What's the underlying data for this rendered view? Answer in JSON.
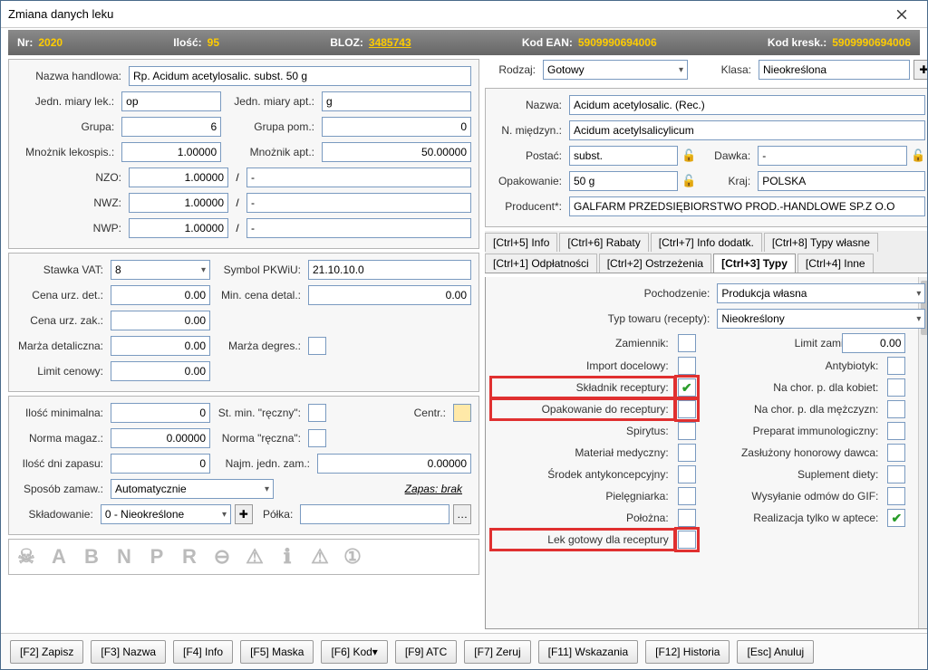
{
  "window": {
    "title": "Zmiana danych leku"
  },
  "infobar": {
    "nr_label": "Nr:",
    "nr_value": "2020",
    "ilosc_label": "Ilość:",
    "ilosc_value": "95",
    "bloz_label": "BLOZ:",
    "bloz_value": "3485743",
    "ean_label": "Kod EAN:",
    "ean_value": "5909990694006",
    "kresk_label": "Kod kresk.:",
    "kresk_value": "5909990694006"
  },
  "left": {
    "nazwa_handlowa_lbl": "Nazwa handlowa:",
    "nazwa_handlowa": "Rp. Acidum acetylosalic. subst. 50 g",
    "jedn_lek_lbl": "Jedn. miary lek.:",
    "jedn_lek": "op",
    "jedn_apt_lbl": "Jedn. miary apt.:",
    "jedn_apt": "g",
    "grupa_lbl": "Grupa:",
    "grupa": "6",
    "grupa_pom_lbl": "Grupa pom.:",
    "grupa_pom": "0",
    "mnoznik_lek_lbl": "Mnożnik lekospis.:",
    "mnoznik_lek": "1.00000",
    "mnoznik_apt_lbl": "Mnożnik apt.:",
    "mnoznik_apt": "50.00000",
    "nzo_lbl": "NZO:",
    "nzo": "1.00000",
    "nzo2": "-",
    "nwz_lbl": "NWZ:",
    "nwz": "1.00000",
    "nwz2": "-",
    "nwp_lbl": "NWP:",
    "nwp": "1.00000",
    "nwp2": "-",
    "vat_lbl": "Stawka VAT:",
    "vat": "8",
    "pkwiu_lbl": "Symbol PKWiU:",
    "pkwiu": "21.10.10.0",
    "cena_det_lbl": "Cena urz. det.:",
    "cena_det": "0.00",
    "min_detal_lbl": "Min. cena detal.:",
    "min_detal": "0.00",
    "cena_zak_lbl": "Cena urz. zak.:",
    "cena_zak": "0.00",
    "marza_det_lbl": "Marża detaliczna:",
    "marza_det": "0.00",
    "marza_degres_lbl": "Marża degres.:",
    "limit_lbl": "Limit cenowy:",
    "limit": "0.00",
    "ilosc_min_lbl": "Ilość minimalna:",
    "ilosc_min": "0",
    "st_min_lbl": "St. min. \"ręczny\":",
    "centr_lbl": "Centr.:",
    "norma_mag_lbl": "Norma magaz.:",
    "norma_mag": "0.00000",
    "norma_recz_lbl": "Norma \"ręczna\":",
    "ilosc_dni_lbl": "Ilość dni zapasu:",
    "ilosc_dni": "0",
    "najm_jedn_lbl": "Najm. jedn. zam.:",
    "najm_jedn": "0.00000",
    "sposob_lbl": "Sposób zamaw.:",
    "sposob": "Automatycznie",
    "zapas_lbl": "Zapas: brak",
    "sklad_lbl": "Składowanie:",
    "sklad": "0 - Nieokreślone",
    "polka_lbl": "Półka:",
    "icons": [
      "☠",
      "A",
      "B",
      "N",
      "P",
      "R",
      "⊖",
      "⚠",
      "ℹ",
      "⚠",
      "①"
    ]
  },
  "right": {
    "rodzaj_lbl": "Rodzaj:",
    "rodzaj": "Gotowy",
    "klasa_lbl": "Klasa:",
    "klasa": "Nieokreślona",
    "nazwa_lbl": "Nazwa:",
    "nazwa": "Acidum acetylosalic. (Rec.)",
    "miedzyn_lbl": "N. międzyn.:",
    "miedzyn": "Acidum acetylsalicylicum",
    "postac_lbl": "Postać:",
    "postac": "subst.",
    "dawka_lbl": "Dawka:",
    "dawka": "-",
    "opak_lbl": "Opakowanie:",
    "opak": "50 g",
    "kraj_lbl": "Kraj:",
    "kraj": "POLSKA",
    "producent_lbl": "Producent*:",
    "producent": "GALFARM PRZEDSIĘBIORSTWO PROD.-HANDLOWE SP.Z O.O",
    "tabs_row1": [
      "[Ctrl+5] Info",
      "[Ctrl+6] Rabaty",
      "[Ctrl+7] Info dodatk.",
      "[Ctrl+8] Typy własne"
    ],
    "tabs_row2": [
      "[Ctrl+1] Odpłatności",
      "[Ctrl+2] Ostrzeżenia",
      "[Ctrl+3] Typy",
      "[Ctrl+4] Inne"
    ],
    "active_tab": "[Ctrl+3] Typy",
    "typy": {
      "pochodz_lbl": "Pochodzenie:",
      "pochodz": "Produkcja własna",
      "typ_tow_lbl": "Typ towaru (recepty):",
      "typ_tow": "Nieokreślony",
      "zamiennik_lbl": "Zamiennik:",
      "limit_zam_lbl": "Limit zamiennika:",
      "limit_zam": "0.00",
      "import_lbl": "Import docelowy:",
      "antybiotyk_lbl": "Antybiotyk:",
      "skladnik_lbl": "Składnik receptury:",
      "chor_k_lbl": "Na chor. p. dla kobiet:",
      "opak_rec_lbl": "Opakowanie do receptury:",
      "chor_m_lbl": "Na chor. p. dla mężczyzn:",
      "spirytus_lbl": "Spirytus:",
      "immun_lbl": "Preparat immunologiczny:",
      "mat_med_lbl": "Materiał medyczny:",
      "dawca_lbl": "Zasłużony honorowy dawca:",
      "antykon_lbl": "Środek antykoncepcyjny:",
      "suplement_lbl": "Suplement diety:",
      "pieleg_lbl": "Pielęgniarka:",
      "gif_lbl": "Wysyłanie odmów do GIF:",
      "polozna_lbl": "Położna:",
      "realiz_lbl": "Realizacja tylko w aptece:",
      "lek_got_lbl": "Lek gotowy dla receptury"
    }
  },
  "footer": {
    "btns": [
      "[F2] Zapisz",
      "[F3] Nazwa",
      "[F4] Info",
      "[F5] Maska",
      "[F6] Kod▾",
      "[F9] ATC",
      "[F7] Zeruj",
      "[F11] Wskazania",
      "[F12] Historia",
      "[Esc] Anuluj"
    ]
  }
}
